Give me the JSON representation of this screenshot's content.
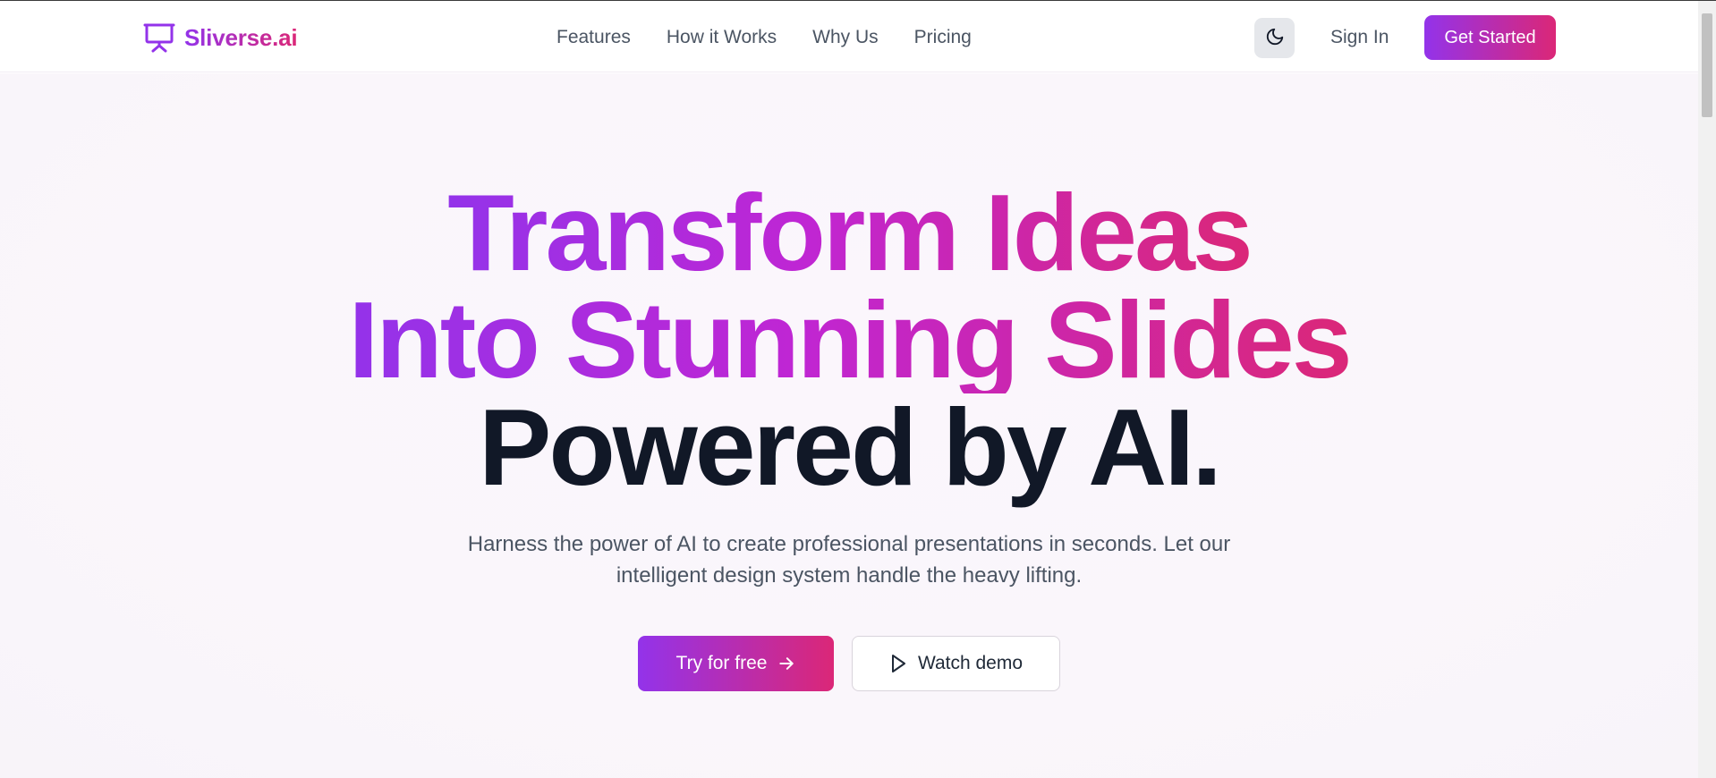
{
  "brand": {
    "name": "Sliverse.ai",
    "logo_icon": "presentation-icon",
    "gradient_start": "#9333ea",
    "gradient_end": "#db2777"
  },
  "nav": {
    "links": [
      "Features",
      "How it Works",
      "Why Us",
      "Pricing"
    ],
    "theme_toggle_icon": "moon-icon",
    "sign_in_label": "Sign In",
    "get_started_label": "Get Started"
  },
  "hero": {
    "headline_line1": "Transform Ideas",
    "headline_line2": "Into Stunning Slides",
    "headline_line3": "Powered by AI.",
    "subtitle_line1": "Harness the power of AI to create professional presentations in seconds. Let our",
    "subtitle_line2": "intelligent design system handle the heavy lifting.",
    "primary_cta_label": "Try for free",
    "primary_cta_icon": "arrow-right-icon",
    "secondary_cta_label": "Watch demo",
    "secondary_cta_icon": "play-icon",
    "headline_dark_color": "#111827"
  }
}
